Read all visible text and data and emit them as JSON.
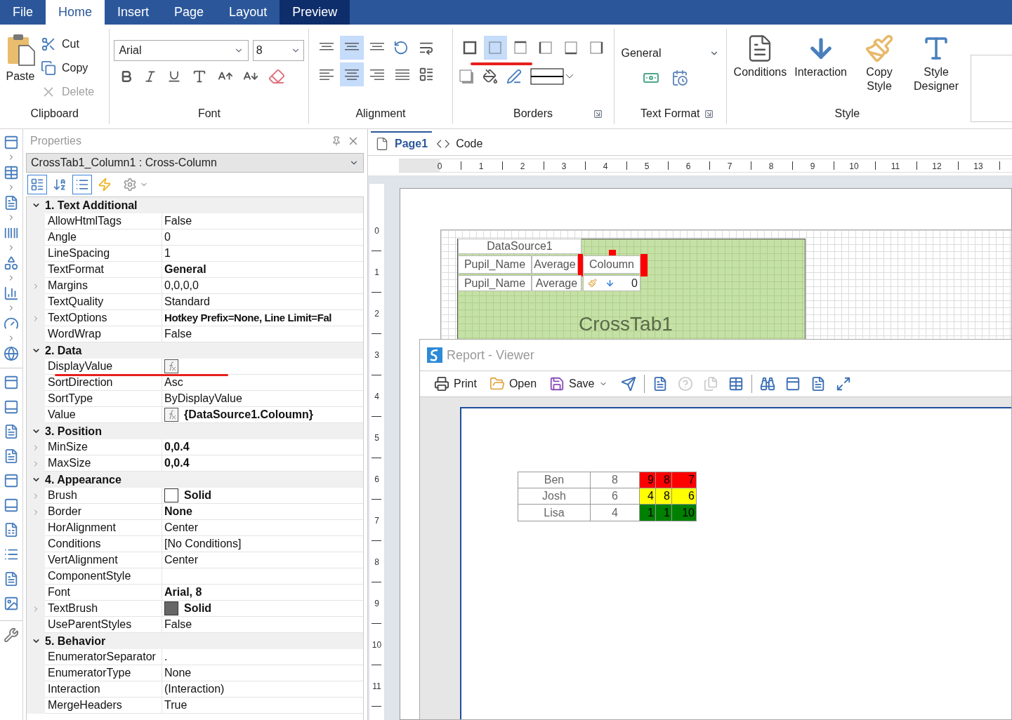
{
  "ribbon_tabs": [
    {
      "label": "File",
      "selected": false,
      "kind": "normal"
    },
    {
      "label": "Home",
      "selected": true,
      "kind": "normal"
    },
    {
      "label": "Insert",
      "selected": false,
      "kind": "normal"
    },
    {
      "label": "Page",
      "selected": false,
      "kind": "normal"
    },
    {
      "label": "Layout",
      "selected": false,
      "kind": "normal"
    },
    {
      "label": "Preview",
      "selected": false,
      "kind": "contextual"
    }
  ],
  "clipboard": {
    "group": "Clipboard",
    "paste": "Paste",
    "items": [
      {
        "label": "Cut",
        "kind": "cut",
        "disabled": false
      },
      {
        "label": "Copy",
        "kind": "copy",
        "disabled": false
      },
      {
        "label": "Delete",
        "kind": "delete",
        "disabled": true
      }
    ]
  },
  "font": {
    "group": "Font",
    "family": "Arial",
    "size": "8"
  },
  "alignment": {
    "group": "Alignment",
    "vertical": [
      {
        "selected": false
      },
      {
        "selected": true
      },
      {
        "selected": false
      }
    ],
    "horizontal": [
      {
        "selected": false
      },
      {
        "selected": true
      },
      {
        "selected": false
      },
      {
        "selected": false
      }
    ]
  },
  "borders": {
    "group": "Borders",
    "sides": [
      {
        "kind": "all",
        "selected": false
      },
      {
        "kind": "none",
        "selected": true
      },
      {
        "kind": "top",
        "selected": false
      },
      {
        "kind": "left",
        "selected": false
      },
      {
        "kind": "bottom",
        "selected": false
      },
      {
        "kind": "right",
        "selected": false
      }
    ]
  },
  "text_format": {
    "group": "Text Format",
    "format": "General"
  },
  "style": {
    "group": "Style",
    "buttons": [
      {
        "label": "Conditions",
        "kind": "conditions"
      },
      {
        "label": "Interaction",
        "kind": "interaction"
      },
      {
        "label": "Copy Style",
        "kind": "copy_style"
      },
      {
        "label": "Style Designer",
        "kind": "designer"
      }
    ]
  },
  "properties": {
    "title": "Properties",
    "object": "CrossTab1_Column1 : Cross-Column",
    "toolbar": [
      {
        "kind": "categorized",
        "selected": true
      },
      {
        "kind": "alphabetical",
        "selected": false
      },
      {
        "kind": "pages",
        "selected": true
      },
      {
        "kind": "events",
        "selected": false
      }
    ],
    "categories": [
      {
        "title": "1. Text Additional",
        "expanded": true,
        "properties": [
          {
            "name": "AllowHtmlTags",
            "value": "False",
            "bold": false,
            "expandable": false
          },
          {
            "name": "Angle",
            "value": "0",
            "bold": false,
            "expandable": false
          },
          {
            "name": "LineSpacing",
            "value": "1",
            "bold": false,
            "expandable": false
          },
          {
            "name": "TextFormat",
            "value": "General",
            "bold": true,
            "expandable": false
          },
          {
            "name": "Margins",
            "value": "0,0,0,0",
            "bold": false,
            "expandable": true
          },
          {
            "name": "TextQuality",
            "value": "Standard",
            "bold": false,
            "expandable": false
          },
          {
            "name": "TextOptions",
            "value": "Hotkey Prefix=None, Line Limit=Fal",
            "bold": true,
            "expandable": true
          },
          {
            "name": "WordWrap",
            "value": "False",
            "bold": false,
            "expandable": false
          }
        ]
      },
      {
        "title": "2. Data",
        "expanded": true,
        "properties": [
          {
            "name": "DisplayValue",
            "kind": "expression",
            "expandable": false
          },
          {
            "name": "SortDirection",
            "value": "Asc",
            "bold": false,
            "expandable": false
          },
          {
            "name": "SortType",
            "value": "ByDisplayValue",
            "bold": false,
            "expandable": false
          },
          {
            "name": "Value",
            "kind": "expression",
            "value": "{DataSource1.Coloumn}",
            "bold": true,
            "expandable": false
          }
        ]
      },
      {
        "title": "3. Position",
        "expanded": true,
        "properties": [
          {
            "name": "MinSize",
            "value": "0,0.4",
            "bold": true,
            "expandable": true
          },
          {
            "name": "MaxSize",
            "value": "0,0.4",
            "bold": true,
            "expandable": true
          }
        ]
      },
      {
        "title": "4. Appearance",
        "expanded": true,
        "properties": [
          {
            "name": "Brush",
            "kind": "swatch",
            "color": "#ffffff",
            "value": "Solid",
            "bold": true,
            "expandable": true
          },
          {
            "name": "Border",
            "value": "None",
            "bold": true,
            "expandable": true
          },
          {
            "name": "HorAlignment",
            "value": "Center",
            "bold": false,
            "expandable": false
          },
          {
            "name": "Conditions",
            "value": "[No Conditions]",
            "bold": false,
            "expandable": false
          },
          {
            "name": "VertAlignment",
            "value": "Center",
            "bold": false,
            "expandable": false
          },
          {
            "name": "ComponentStyle",
            "expandable": false
          },
          {
            "name": "Font",
            "value": "Arial, 8",
            "bold": true,
            "expandable": false
          },
          {
            "name": "TextBrush",
            "kind": "swatch",
            "color": "#666666",
            "value": "Solid",
            "bold": true,
            "expandable": true
          },
          {
            "name": "UseParentStyles",
            "value": "False",
            "bold": false,
            "expandable": false
          }
        ]
      },
      {
        "title": "5. Behavior",
        "expanded": true,
        "properties": [
          {
            "name": "EnumeratorSeparator",
            "value": ".",
            "bold": false,
            "expandable": false
          },
          {
            "name": "EnumeratorType",
            "value": "None",
            "bold": false,
            "expandable": false
          },
          {
            "name": "Interaction",
            "value": "(Interaction)",
            "bold": false,
            "expandable": false
          },
          {
            "name": "MergeHeaders",
            "value": "True",
            "bold": false,
            "expandable": false
          }
        ]
      }
    ]
  },
  "designer_tabs": [
    {
      "label": "Page1",
      "kind": "page",
      "selected": true
    },
    {
      "label": "Code",
      "kind": "code",
      "selected": false
    }
  ],
  "ruler": {
    "horizontal": [
      "0",
      "1",
      "2",
      "3",
      "4",
      "5",
      "6",
      "7",
      "8",
      "9",
      "10",
      "11",
      "12",
      "13"
    ],
    "vertical": [
      "0",
      "1",
      "2",
      "3",
      "4",
      "5",
      "6",
      "7",
      "8",
      "9",
      "10",
      "11"
    ]
  },
  "crosstab": {
    "data_source": "DataSource1",
    "header_cells": [
      "Pupil_Name",
      "Average",
      "Coloumn"
    ],
    "data_cells": [
      "Pupil_Name",
      "Average"
    ],
    "total": "0",
    "name": "CrossTab1"
  },
  "viewer": {
    "title": "Report - Viewer",
    "buttons": [
      {
        "label": "Print",
        "kind": "print",
        "dropdown": false
      },
      {
        "label": "Open",
        "kind": "open",
        "dropdown": false
      },
      {
        "label": "Save",
        "kind": "save",
        "dropdown": true
      }
    ],
    "tools": [
      {
        "kind": "send",
        "disabled": false
      },
      {
        "kind": "toc",
        "disabled": false
      },
      {
        "kind": "help",
        "disabled": true
      },
      {
        "kind": "copy",
        "disabled": true
      },
      {
        "kind": "table",
        "disabled": false
      },
      {
        "kind": "find",
        "disabled": false
      },
      {
        "kind": "page",
        "disabled": false
      },
      {
        "kind": "fit",
        "disabled": false
      },
      {
        "kind": "width",
        "disabled": false
      }
    ],
    "rows": [
      {
        "name": "Ben",
        "average": "8",
        "cells": [
          {
            "value": "9",
            "color": "#ff0000"
          },
          {
            "value": "8",
            "color": "#ff0000"
          },
          {
            "value": "7",
            "color": "#ff0000"
          }
        ]
      },
      {
        "name": "Josh",
        "average": "6",
        "cells": [
          {
            "value": "4",
            "color": "#ffff00"
          },
          {
            "value": "8",
            "color": "#ffff00"
          },
          {
            "value": "6",
            "color": "#ffff00"
          }
        ]
      },
      {
        "name": "Lisa",
        "average": "4",
        "cells": [
          {
            "value": "1",
            "color": "#008000"
          },
          {
            "value": "1",
            "color": "#008000"
          },
          {
            "value": "10",
            "color": "#008000"
          }
        ]
      }
    ]
  }
}
